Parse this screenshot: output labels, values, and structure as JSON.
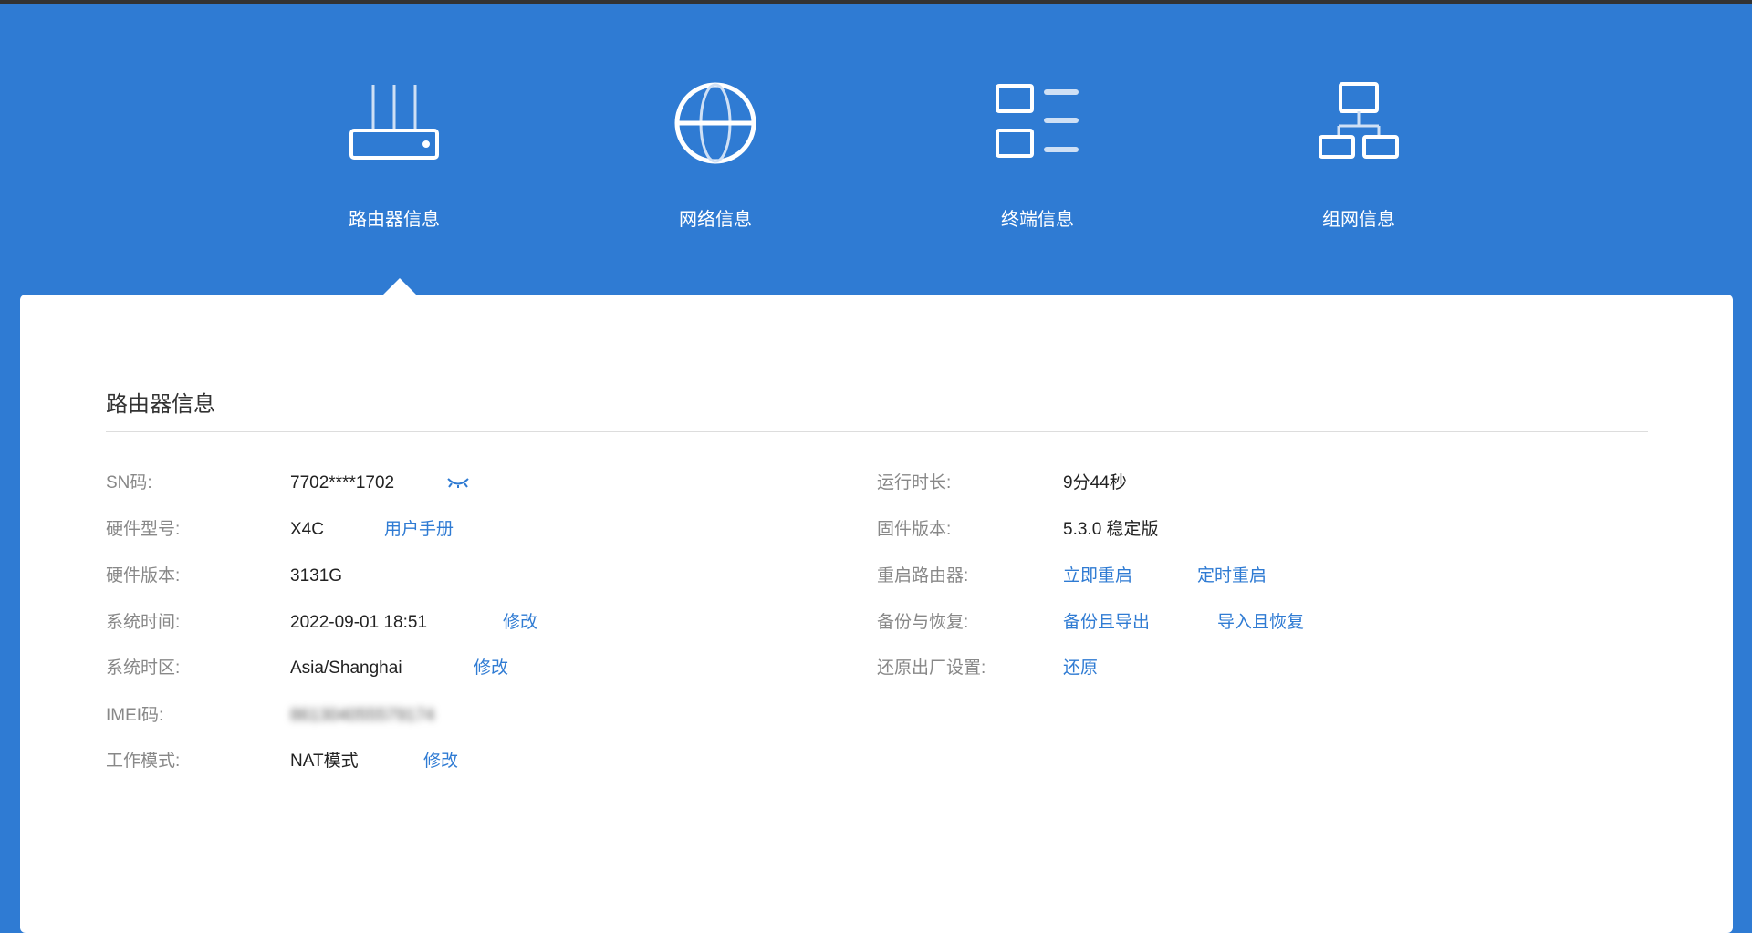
{
  "colors": {
    "brand": "#2f7bd3",
    "link": "#2f7bd3"
  },
  "nav": [
    {
      "label": "路由器信息",
      "icon": "router-icon",
      "active": true
    },
    {
      "label": "网络信息",
      "icon": "globe-icon"
    },
    {
      "label": "终端信息",
      "icon": "device-list-icon"
    },
    {
      "label": "组网信息",
      "icon": "mesh-network-icon"
    }
  ],
  "card": {
    "title": "路由器信息"
  },
  "left": [
    {
      "label": "SN码:",
      "value": "7702****1702",
      "icon": "eye-closed-icon"
    },
    {
      "label": "硬件型号:",
      "value": "X4C",
      "link": "用户手册"
    },
    {
      "label": "硬件版本:",
      "value": "3131G"
    },
    {
      "label": "系统时间:",
      "value": "2022-09-01 18:51",
      "link": "修改"
    },
    {
      "label": "系统时区:",
      "value": "Asia/Shanghai",
      "link": "修改"
    },
    {
      "label": "IMEI码:",
      "value": "861304055579174"
    },
    {
      "label": "工作模式:",
      "value": "NAT模式",
      "link": "修改"
    }
  ],
  "right": [
    {
      "label": "运行时长:",
      "value": "9分44秒"
    },
    {
      "label": "固件版本:",
      "value": "5.3.0 稳定版"
    },
    {
      "label": "重启路由器:",
      "links": [
        "立即重启",
        "定时重启"
      ]
    },
    {
      "label": "备份与恢复:",
      "links": [
        "备份且导出",
        "导入且恢复"
      ]
    },
    {
      "label": "还原出厂设置:",
      "links": [
        "还原"
      ]
    }
  ]
}
